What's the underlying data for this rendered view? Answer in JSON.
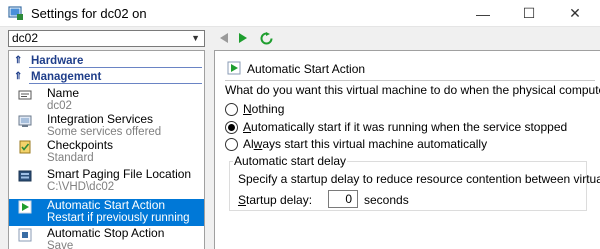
{
  "window": {
    "title": "Settings for dc02 on",
    "icon": "settings-app-icon",
    "controls": {
      "minimize": "—",
      "maximize": "☐",
      "close": "✕"
    }
  },
  "toolbar": {
    "vm_selected": "dc02",
    "back_icon": "back-arrow-icon",
    "forward_icon": "forward-arrow-icon",
    "refresh_icon": "refresh-icon"
  },
  "sidebar": {
    "groups": [
      {
        "label": "Hardware"
      },
      {
        "label": "Management"
      }
    ],
    "items": [
      {
        "label": "Name",
        "sub": "dc02",
        "icon": "name-tag-icon"
      },
      {
        "label": "Integration Services",
        "sub": "Some services offered",
        "icon": "integration-services-icon"
      },
      {
        "label": "Checkpoints",
        "sub": "Standard",
        "icon": "checkpoint-icon"
      },
      {
        "label": "Smart Paging File Location",
        "sub": "C:\\VHD\\dc02",
        "icon": "paging-file-icon"
      },
      {
        "label": "Automatic Start Action",
        "sub": "Restart if previously running",
        "icon": "start-action-icon",
        "selected": true
      },
      {
        "label": "Automatic Stop Action",
        "sub": "Save",
        "icon": "stop-action-icon"
      }
    ]
  },
  "main": {
    "section_title": "Automatic Start Action",
    "question": "What do you want this virtual machine to do when the physical computer starts?",
    "options": [
      {
        "pre": "",
        "key": "N",
        "post": "othing",
        "checked": false
      },
      {
        "pre": "",
        "key": "A",
        "post": "utomatically start if it was running when the service stopped",
        "checked": true
      },
      {
        "pre": "Al",
        "key": "w",
        "post": "ays start this virtual machine automatically",
        "checked": false
      }
    ],
    "delay_group": {
      "legend": "Automatic start delay",
      "description": "Specify a startup delay to reduce resource contention between virtual machines.",
      "label_pre": "",
      "label_key": "S",
      "label_post": "tartup delay:",
      "value": "0",
      "unit": "seconds"
    }
  },
  "colors": {
    "selection": "#0078d7",
    "group_header": "#1f3e8a",
    "nav_green": "#1e9e2e",
    "nav_disabled": "#9a9a9a"
  }
}
